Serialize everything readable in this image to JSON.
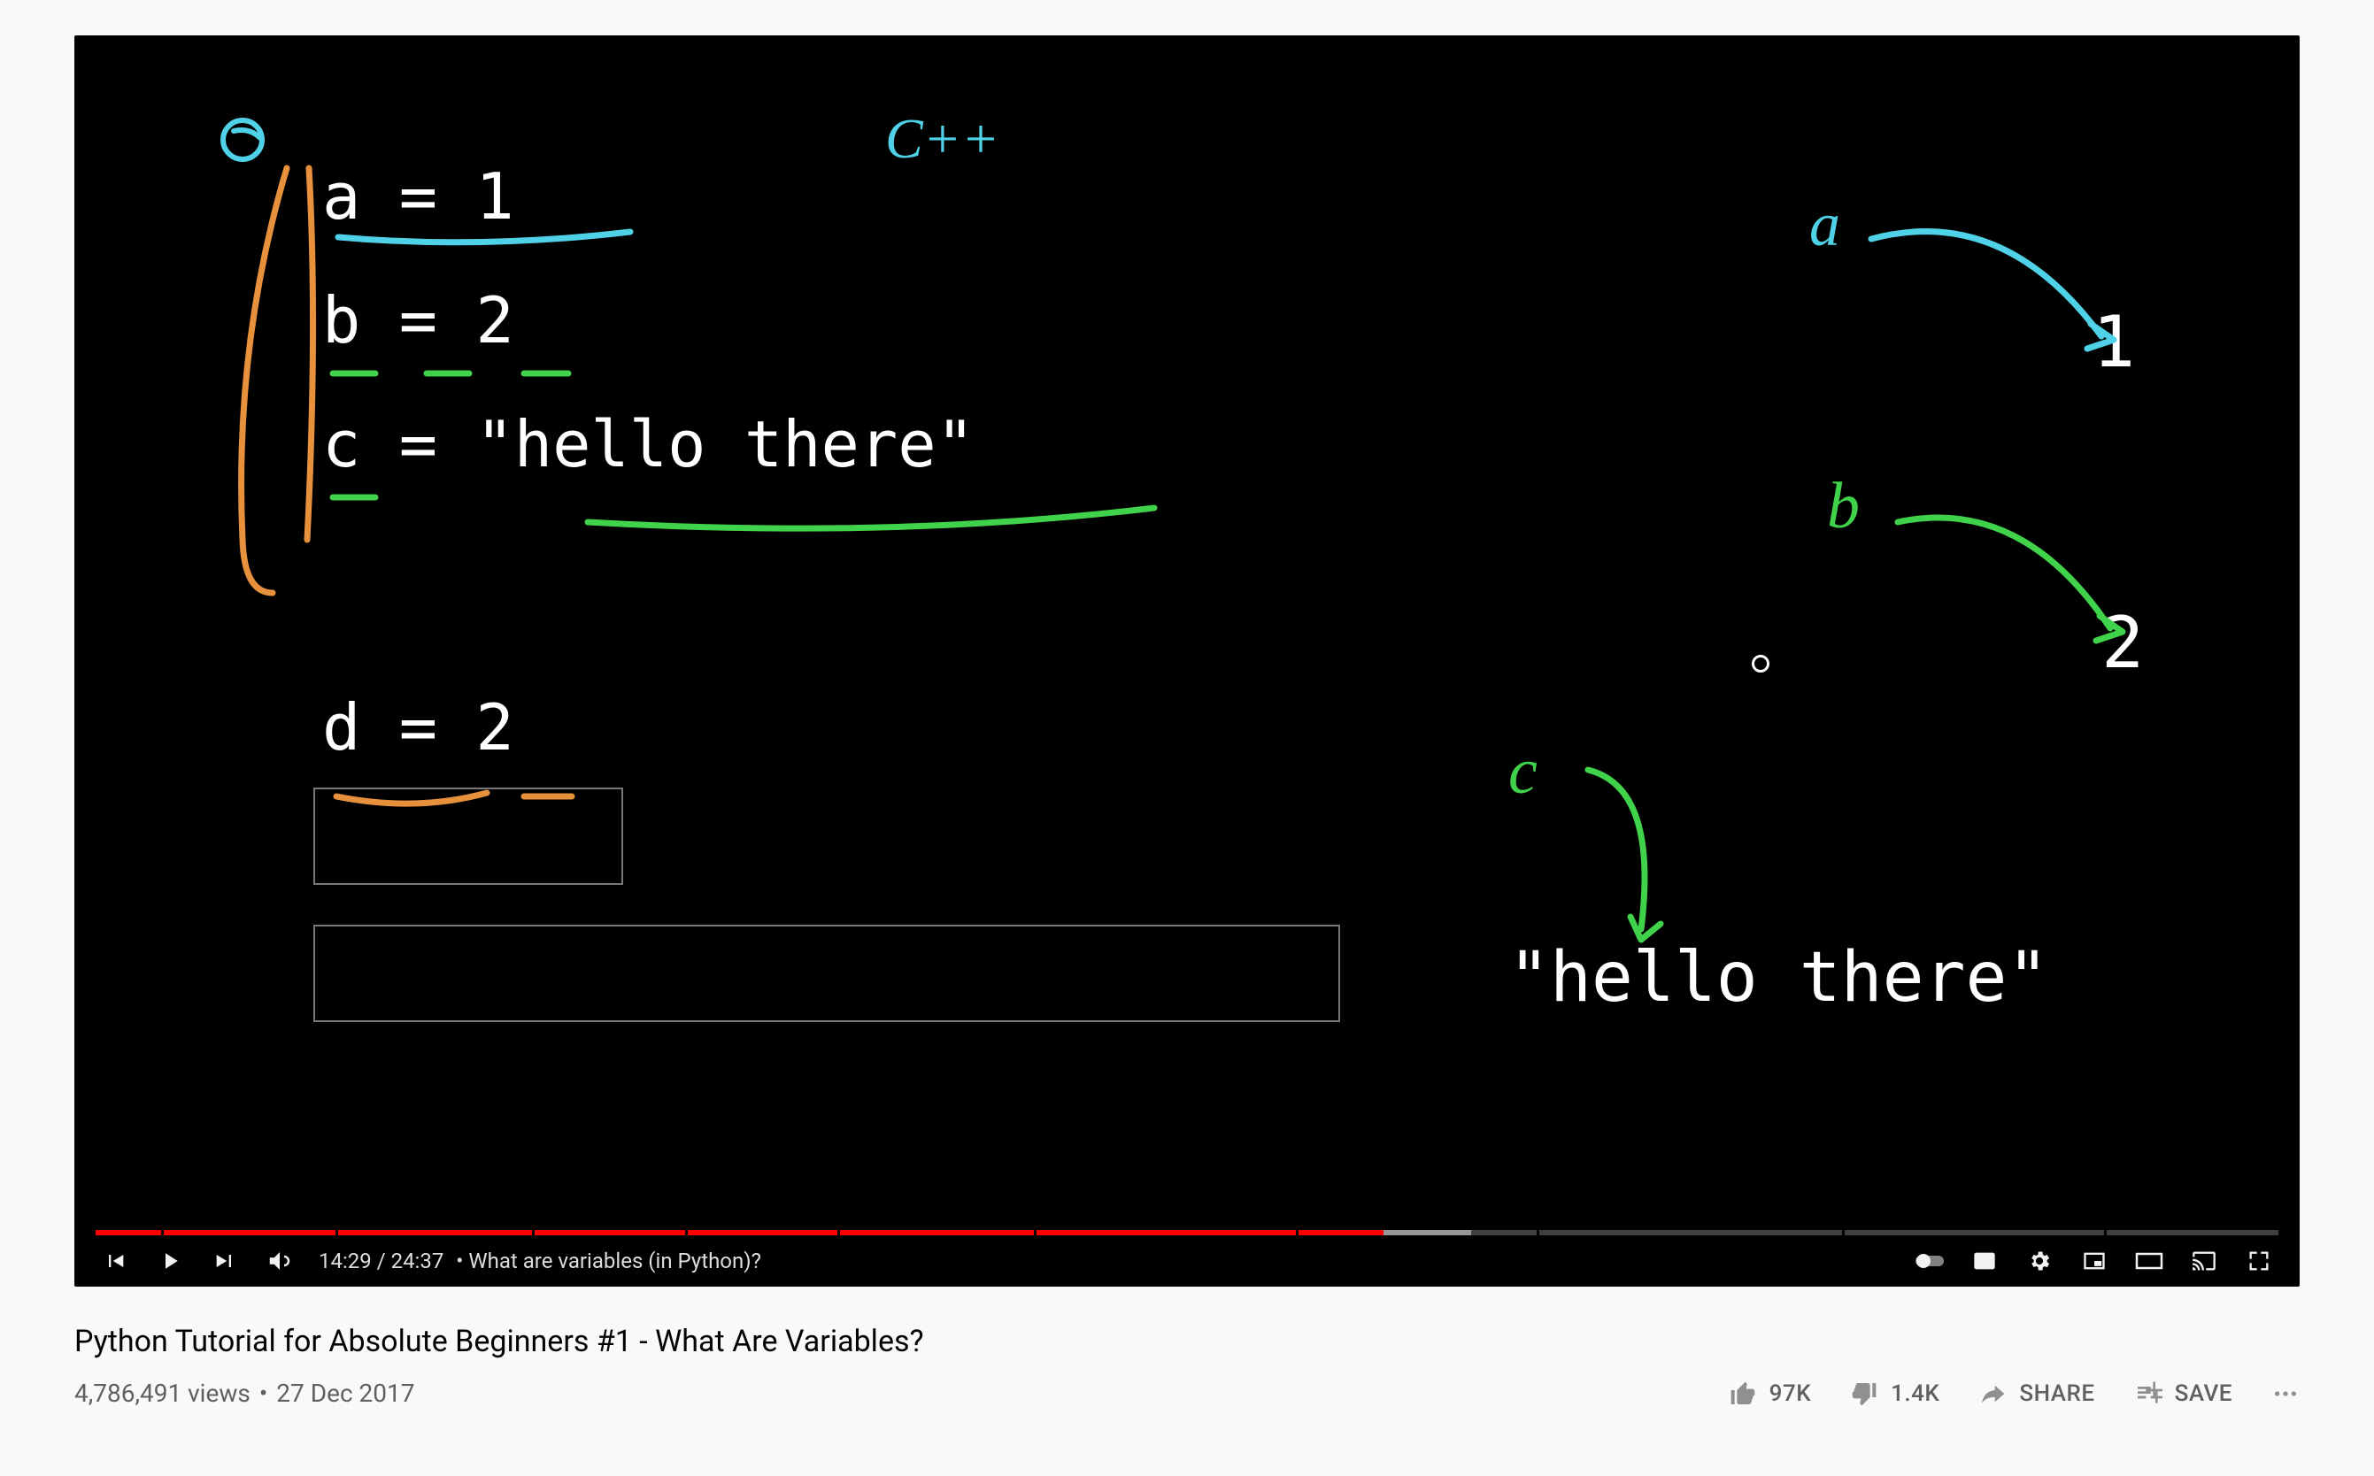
{
  "video": {
    "heading_note": "C++",
    "code_lines": {
      "l1": "a = 1",
      "l2": "b = 2",
      "l3": "c = \"hello there\"",
      "l4": "d = 2"
    },
    "right_vars": {
      "a": "a",
      "a_val": "1",
      "b": "b",
      "b_val": "2",
      "c": "c",
      "c_val": "\"hello there\""
    },
    "progress": {
      "played_pct": 59,
      "buffered_pct": 63
    },
    "time_current": "14:29",
    "time_total": "24:37",
    "chapter_label": "What are variables (in Python)?"
  },
  "below": {
    "title": "Python Tutorial for Absolute Beginners #1 - What Are Variables?",
    "views": "4,786,491 views",
    "date": "27 Dec 2017",
    "likes": "97K",
    "dislikes": "1.4K",
    "share": "SHARE",
    "save": "SAVE"
  }
}
